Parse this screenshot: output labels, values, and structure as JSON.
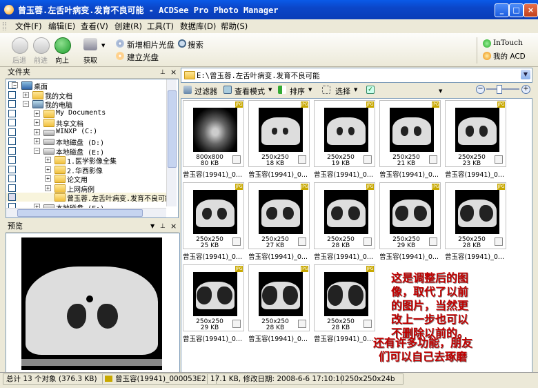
{
  "window": {
    "title": "曾玉蓉.左舌叶病变.发育不良可能 - ACDSee Pro Photo Manager"
  },
  "menu": [
    "文件(F)",
    "编辑(E)",
    "查看(V)",
    "创建(R)",
    "工具(T)",
    "数据库(D)",
    "帮助(S)"
  ],
  "toolbar": {
    "back": "后退",
    "forward": "前进",
    "up": "向上",
    "acquire": "获取",
    "add_disc": "新增相片光盘",
    "search": "搜索",
    "create_disc": "建立光盘",
    "intouch": "InTouch",
    "my_acd": "我的 ACD"
  },
  "folders_pane": {
    "title": "文件夹",
    "items": [
      {
        "label": "桌面"
      },
      {
        "label": "我的文档"
      },
      {
        "label": "我的电脑"
      },
      {
        "label": "My Documents"
      },
      {
        "label": "共享文档"
      },
      {
        "label": "WINXP (C:)"
      },
      {
        "label": "本地磁盘 (D:)"
      },
      {
        "label": "本地磁盘 (E:)"
      },
      {
        "label": "1.医学影像全集"
      },
      {
        "label": "2.华西影像"
      },
      {
        "label": "论文用"
      },
      {
        "label": "上网病例"
      },
      {
        "label": "曾玉蓉.左舌叶病变.发育不良可能"
      },
      {
        "label": "本地磁盘 (F:)"
      }
    ]
  },
  "preview_pane": {
    "title": "预览"
  },
  "address": "E:\\曾玉蓉.左舌叶病变.发育不良可能",
  "subtoolbar": {
    "filter": "过滤器",
    "view_mode": "查看模式",
    "sort": "排序",
    "select": "选择"
  },
  "thumbnails": [
    {
      "dims": "800x800",
      "size": "80 KB",
      "name": "曾玉容(19941)_0..."
    },
    {
      "dims": "250x250",
      "size": "18 KB",
      "name": "曾玉容(19941)_0..."
    },
    {
      "dims": "250x250",
      "size": "19 KB",
      "name": "曾玉容(19941)_0..."
    },
    {
      "dims": "250x250",
      "size": "21 KB",
      "name": "曾玉容(19941)_0..."
    },
    {
      "dims": "250x250",
      "size": "23 KB",
      "name": "曾玉容(19941)_0..."
    },
    {
      "dims": "250x250",
      "size": "25 KB",
      "name": "曾玉容(19941)_0..."
    },
    {
      "dims": "250x250",
      "size": "27 KB",
      "name": "曾玉容(19941)_0..."
    },
    {
      "dims": "250x250",
      "size": "28 KB",
      "name": "曾玉容(19941)_0..."
    },
    {
      "dims": "250x250",
      "size": "29 KB",
      "name": "曾玉容(19941)_0..."
    },
    {
      "dims": "250x250",
      "size": "28 KB",
      "name": "曾玉容(19941)_0..."
    },
    {
      "dims": "250x250",
      "size": "29 KB",
      "name": "曾玉容(19941)_0..."
    },
    {
      "dims": "250x250",
      "size": "28 KB",
      "name": "曾玉容(19941)_0..."
    },
    {
      "dims": "250x250",
      "size": "28 KB",
      "name": "曾玉容(19941)_0..."
    }
  ],
  "annotations": {
    "note1": [
      "这是调整后的图",
      "像，取代了以前",
      "的图片，当然更",
      "改上一步也可以",
      "不删除以前的。"
    ],
    "note2": [
      "还有许多功能，朋友",
      "们可以自己去琢磨"
    ]
  },
  "status": {
    "total": "总计 13 个对象 (376.3 KB)",
    "file": "曾玉容(19941)_000053E2",
    "info": "17.1 KB, 修改日期: 2008-6-6 17:10:10",
    "dims": "250x250x24b"
  }
}
